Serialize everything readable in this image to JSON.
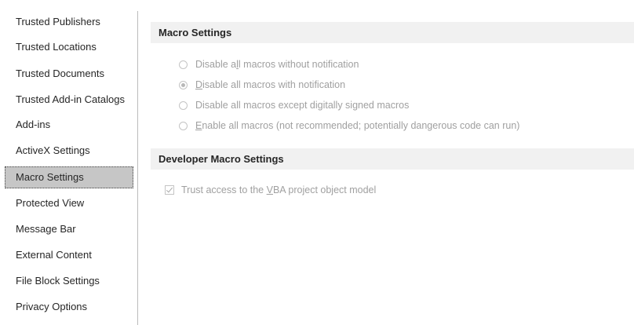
{
  "sidebar": {
    "items": [
      {
        "label": "Trusted Publishers",
        "selected": false
      },
      {
        "label": "Trusted Locations",
        "selected": false
      },
      {
        "label": "Trusted Documents",
        "selected": false
      },
      {
        "label": "Trusted Add-in Catalogs",
        "selected": false
      },
      {
        "label": "Add-ins",
        "selected": false
      },
      {
        "label": "ActiveX Settings",
        "selected": false
      },
      {
        "label": "Macro Settings",
        "selected": true
      },
      {
        "label": "Protected View",
        "selected": false
      },
      {
        "label": "Message Bar",
        "selected": false
      },
      {
        "label": "External Content",
        "selected": false
      },
      {
        "label": "File Block Settings",
        "selected": false
      },
      {
        "label": "Privacy Options",
        "selected": false
      }
    ]
  },
  "macro_settings": {
    "header": "Macro Settings",
    "options": [
      {
        "pre": "Disable a",
        "accel": "l",
        "post": "l macros without notification",
        "checked": false
      },
      {
        "pre": "",
        "accel": "D",
        "post": "isable all macros with notification",
        "checked": true
      },
      {
        "pre": "Disable all macros except digitally signed macros",
        "accel": "",
        "post": "",
        "checked": false
      },
      {
        "pre": "",
        "accel": "E",
        "post": "nable all macros (not recommended; potentially dangerous code can run)",
        "checked": false
      }
    ]
  },
  "developer_settings": {
    "header": "Developer Macro Settings",
    "trust_vba": {
      "pre": "Trust access to the ",
      "accel": "V",
      "post": "BA project object model",
      "checked": true
    }
  }
}
